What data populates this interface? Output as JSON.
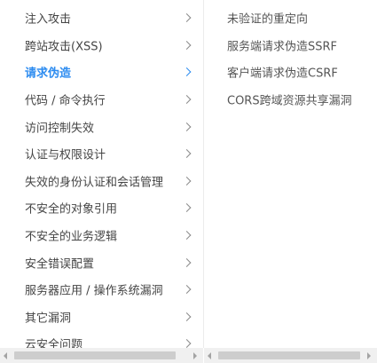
{
  "categories": [
    {
      "label": "注入攻击"
    },
    {
      "label": "跨站攻击(XSS)"
    },
    {
      "label": "请求伪造"
    },
    {
      "label": "代码 / 命令执行"
    },
    {
      "label": "访问控制失效"
    },
    {
      "label": "认证与权限设计"
    },
    {
      "label": "失效的身份认证和会话管理"
    },
    {
      "label": "不安全的对象引用"
    },
    {
      "label": "不安全的业务逻辑"
    },
    {
      "label": "安全错误配置"
    },
    {
      "label": "服务器应用 / 操作系统漏洞"
    },
    {
      "label": "其它漏洞"
    },
    {
      "label": "云安全问题"
    }
  ],
  "active_category": "请求伪造",
  "subcategories": [
    {
      "label": "未验证的重定向"
    },
    {
      "label": "服务端请求伪造SSRF"
    },
    {
      "label": "客户端请求伪造CSRF"
    },
    {
      "label": "CORS跨域资源共享漏洞"
    }
  ],
  "icons": {
    "item_arrow": "chevron-right-icon",
    "scroll_left": "scroll-left-arrow-icon",
    "scroll_right": "scroll-right-arrow-icon"
  },
  "colors": {
    "active": "#2d8cf0",
    "text": "#444444",
    "chevron": "#8a8a8a",
    "scrollbar_bg": "#f0f0f0",
    "scrollbar_thumb": "#cdcdcd"
  }
}
